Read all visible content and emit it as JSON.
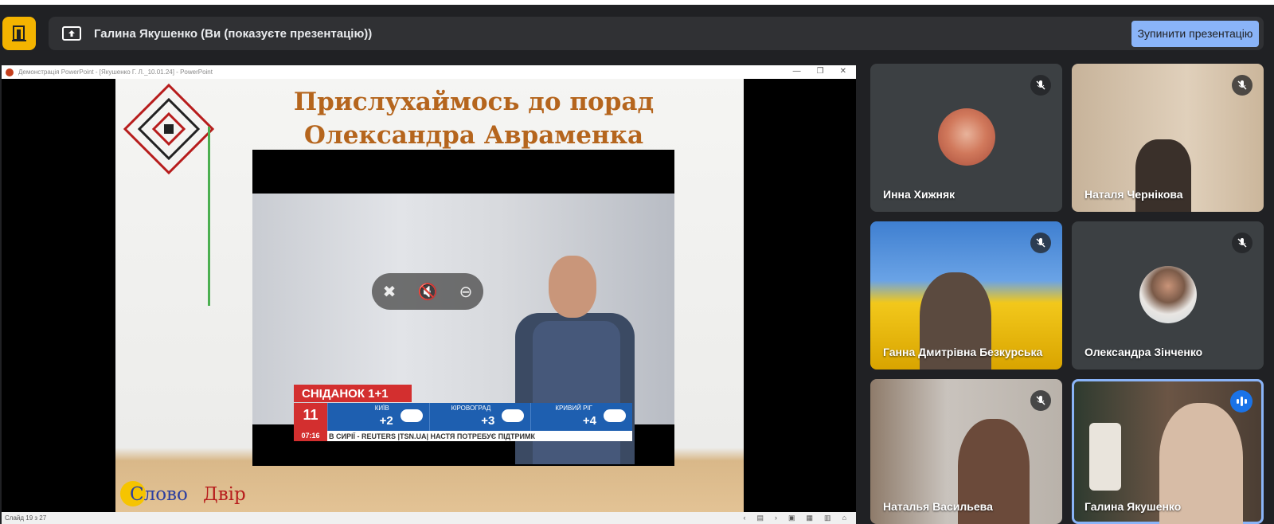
{
  "presentation_bar": {
    "label": "Галина Якушенко (Ви (показуєте презентацію))",
    "stop_button": "Зупинити презентацію"
  },
  "powerpoint": {
    "window_title": "Демонстрація PowerPoint - [Якушенко Г. Л._10.01.24] - PowerPoint",
    "status": "Слайд 19 з 27",
    "slide_title": "Прислухаймось до порад Олександра Авраменка",
    "logo_text_1": "Слово",
    "logo_text_2": "Двір",
    "video": {
      "banner": "СНІДАНОК 1+1",
      "date_day": "11",
      "date_time": "07:16",
      "weather": [
        {
          "city": "КИЇВ",
          "temp": "+2"
        },
        {
          "city": "КІРОВОГРАД",
          "temp": "+3"
        },
        {
          "city": "КРИВИЙ РІГ",
          "temp": "+4"
        }
      ],
      "ticker": "В СИРІЇ - REUTERS  |TSN.UA|  НАСТЯ ПОТРЕБУЄ ПІДТРИМК"
    }
  },
  "participants": [
    {
      "name": "Инна Хижняк",
      "muted": true
    },
    {
      "name": "Наталя Чернікова",
      "muted": true
    },
    {
      "name": "Ганна Дмитрівна Безкурська",
      "muted": true
    },
    {
      "name": "Олександра Зінченко",
      "muted": true
    },
    {
      "name": "Наталья Васильева",
      "muted": true
    },
    {
      "name": "Галина Якушенко",
      "muted": false,
      "speaking": true
    }
  ],
  "colors": {
    "accent": "#8ab4f8",
    "background": "#202124",
    "tile": "#3c4043",
    "logo": "#f4b400"
  }
}
